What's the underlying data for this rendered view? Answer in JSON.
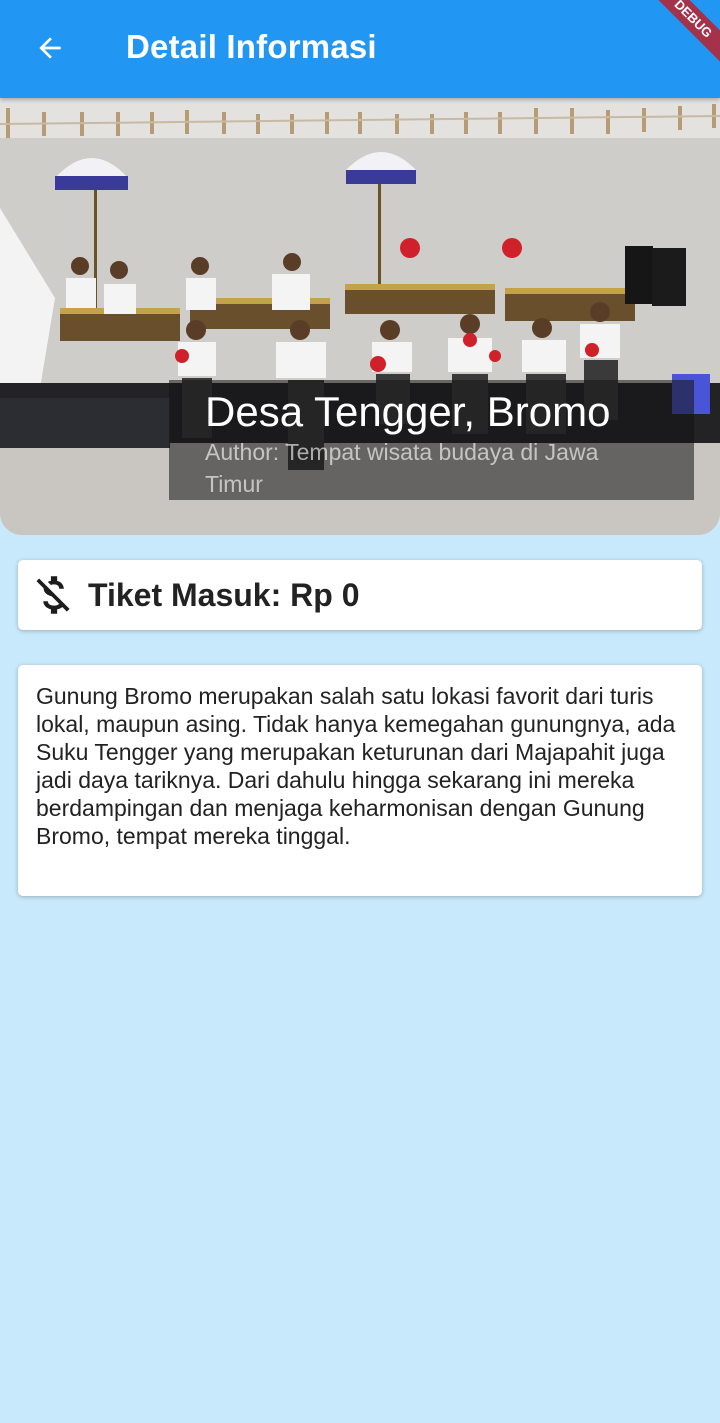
{
  "appbar": {
    "title": "Detail Informasi",
    "back_icon": "arrow-left-icon",
    "color": "#2196f3",
    "debug_banner": "DEBUG"
  },
  "hero": {
    "title": "Desa Tengger, Bromo",
    "author": "Author: Tempat wisata budaya di Jawa Timur"
  },
  "ticket": {
    "icon": "money-off-icon",
    "label": "Tiket Masuk: Rp 0"
  },
  "description": {
    "text": "Gunung Bromo merupakan salah satu lokasi favorit dari turis lokal, maupun asing. Tidak hanya kemegahan gunungnya, ada Suku Tengger yang merupakan keturunan dari Majapahit juga jadi daya tariknya. Dari dahulu hingga sekarang ini mereka berdampingan dan menjaga keharmonisan dengan Gunung Bromo, tempat mereka tinggal."
  },
  "colors": {
    "background": "#c8e8fb",
    "card": "#ffffff"
  }
}
